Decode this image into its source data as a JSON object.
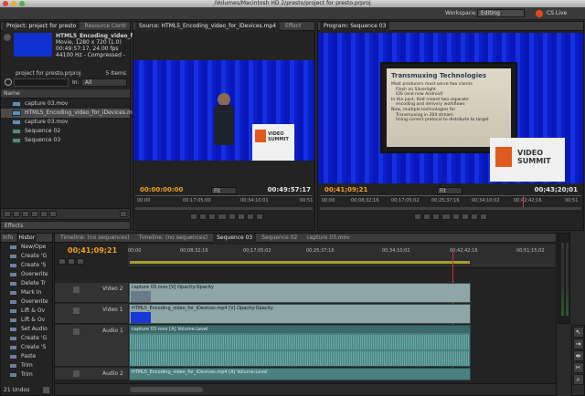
{
  "window": {
    "title": "/Volumes/Macintosh HD 2/presto/project for presto.prproj"
  },
  "workspace": {
    "label": "Workspace:",
    "value": "Editing",
    "cs_live": "CS Live"
  },
  "project_panel": {
    "tabs": [
      "Project: project for presto",
      "Resource Centr"
    ],
    "preview_info": {
      "name": "HTML5_Encoding_video_f...",
      "line1": "Movie, 1280 x 720 (1.0)",
      "line2": "00:49:57:17, 24.00 fps",
      "line3": "44100 Hz - Compressed -"
    },
    "project_file": "project for presto.prproj",
    "item_count": "5 Items",
    "in_label": "In:",
    "in_value": "All",
    "name_header": "Name",
    "items": [
      {
        "label": "capture 03.mov",
        "selected": false
      },
      {
        "label": "HTML5_Encoding_video_for_iDevices.mp4",
        "selected": true
      },
      {
        "label": "capture 03.mov",
        "selected": false
      },
      {
        "label": "Sequence 02",
        "selected": false
      },
      {
        "label": "Sequence 03",
        "selected": false
      }
    ]
  },
  "effects_tab": "Effects",
  "source_monitor": {
    "tabs": [
      "Source: HTML5_Encoding_video_for_iDevices.mp4",
      "Effect"
    ],
    "timecode_in": "00:00:00:00",
    "fit": "Fit",
    "timecode_dur": "00:49:57:17",
    "ruler": [
      "00:00",
      "00:17:05:00",
      "00:34:10:01",
      "00:51"
    ]
  },
  "program_monitor": {
    "tabs": [
      "Program: Sequence 03"
    ],
    "slide_title": "Transmuxing Technologies",
    "slide_lines": [
      "Most producers must serve two clients",
      "Flash on Silverlight",
      "iOS (and now Android)",
      "In the past, that meant two separate",
      "encoding and delivery workflows",
      "Now, multiple technologies for",
      "Transmuxing in 264 stream",
      "Using correct protocol to distribute to target"
    ],
    "summit_label": "VIDEO SUMMIT",
    "timecode_in": "00;41;09;21",
    "fit": "Fit",
    "timecode_dur": "00;43;20;01",
    "ruler": [
      "00;00",
      "00;08;32;16",
      "00;17;05;02",
      "00;25;37;16",
      "00;34;10;02",
      "00;42;42;16",
      "00;51"
    ]
  },
  "history_panel": {
    "tabs": [
      "Info",
      "Histor"
    ],
    "items": [
      "New/Ope",
      "Create 'G",
      "Create 'S",
      "Overwrite",
      "Delete Tr",
      "Mark In",
      "Overwrite",
      "Lift & Ov",
      "Lift & Ov",
      "Set Audio",
      "Create 'G",
      "Create 'S",
      "Paste",
      "Trim",
      "Trim"
    ],
    "undos": "21 Undos"
  },
  "timeline": {
    "tabs": [
      "Timeline: (no sequences)",
      "Timeline: (no sequences)",
      "Sequence 03",
      "Sequence 02",
      "capture 03.mov"
    ],
    "timecode": "00;41;09;21",
    "ruler": [
      "00;00",
      "00;08;32;16",
      "00;17;05;02",
      "00;25;37;16",
      "00;34;10;02",
      "00;42;42;16",
      "00;51;15;02"
    ],
    "tracks": {
      "video2": "Video 2",
      "video1": "Video 1",
      "audio1": "Audio 1",
      "audio2": "Audio 2"
    },
    "clips": {
      "v2": "capture 03.mov [V] Opacity:Opacity",
      "v1": "HTML5_Encoding_video_for_iDevices.mp4 [V] Opacity:Opacity",
      "a1": "capture 03.mov [A] Volume:Level",
      "a2": "HTML5_Encoding_video_for_iDevices.mp4 [A] Volume:Level"
    }
  }
}
